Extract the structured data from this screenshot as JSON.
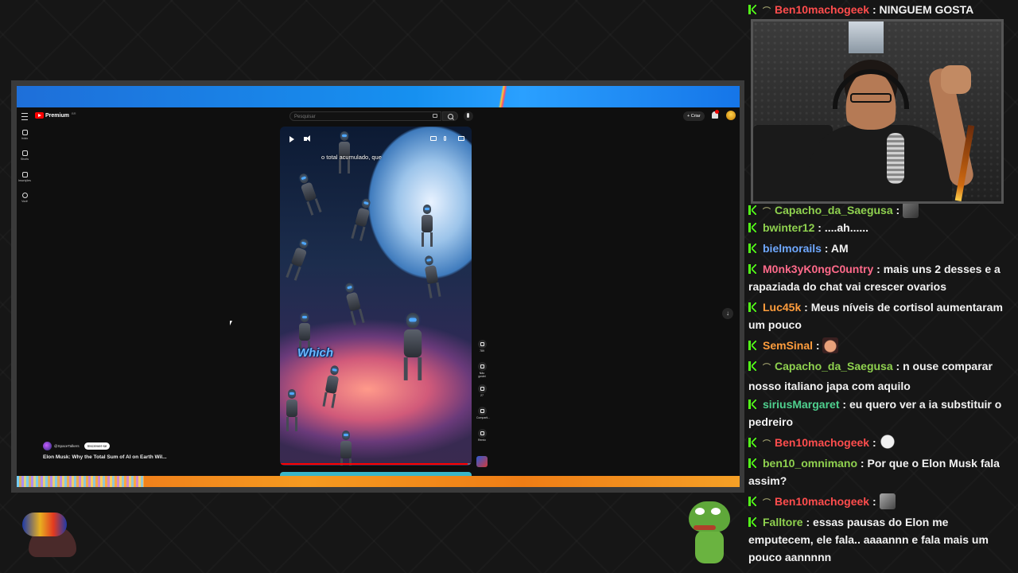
{
  "youtube": {
    "logo_text": "Premium",
    "logo_region": "BR",
    "search_placeholder": "Pesquisar",
    "create_label": "Criar",
    "sidebar": [
      {
        "label": "Início",
        "icon": "home-icon"
      },
      {
        "label": "Shorts",
        "icon": "shorts-icon"
      },
      {
        "label": "Inscrições",
        "icon": "subscriptions-icon"
      },
      {
        "label": "Você",
        "icon": "you-icon"
      }
    ],
    "video": {
      "caption": "o total acumulado, que",
      "overlay_word": "Which",
      "progress_percent": 98
    },
    "actions": [
      {
        "label": "789",
        "icon": "like-icon"
      },
      {
        "label": "Não gostei",
        "icon": "dislike-icon"
      },
      {
        "label": "27",
        "icon": "comment-icon"
      },
      {
        "label": "Comparti...",
        "icon": "share-icon"
      },
      {
        "label": "Remix",
        "icon": "remix-icon"
      }
    ],
    "channel": {
      "handle": "@SpaceTalkers",
      "subscribe_label": "Inscrever-se"
    },
    "video_title": "Elon Musk: Why the Total Sum of AI on Earth Wil..."
  },
  "chat": {
    "messages": [
      {
        "user": "Ben10machogeek",
        "color": "#ff4d4d",
        "hat": true,
        "text": "NINGUEM GOSTA"
      },
      {
        "user": "Capacho_da_Saegusa",
        "color": "#8fd14f",
        "hat": true,
        "text": "",
        "emote": "image-emote"
      },
      {
        "user": "bwinter12",
        "color": "#8fd14f",
        "hat": false,
        "text": "....ah......"
      },
      {
        "user": "bielmorails",
        "color": "#6fa8ff",
        "hat": false,
        "text": "AM"
      },
      {
        "user": "M0nk3yK0ngC0untry",
        "color": "#ff6a8a",
        "hat": false,
        "text": "mais uns 2 desses e a rapaziada do chat vai crescer ovarios"
      },
      {
        "user": "Luc45k",
        "color": "#ff9d3d",
        "hat": false,
        "text": "Meus níveis de cortisol aumentaram um pouco"
      },
      {
        "user": "SemSinal",
        "color": "#ff9d3d",
        "hat": false,
        "text": "",
        "emote": "hand-emote"
      },
      {
        "user": "Capacho_da_Saegusa",
        "color": "#8fd14f",
        "hat": true,
        "text": "n ouse comparar nosso italiano japa com aquilo"
      },
      {
        "user": "siriusMargaret",
        "color": "#4fd18f",
        "hat": false,
        "text": "eu quero ver a ia substituir o pedreiro"
      },
      {
        "user": "Ben10machogeek",
        "color": "#ff4d4d",
        "hat": true,
        "text": "",
        "emote": "ghost-emote"
      },
      {
        "user": "ben10_omnimano",
        "color": "#8fd14f",
        "hat": false,
        "text": "Por que o Elon Musk fala assim?"
      },
      {
        "user": "Ben10machogeek",
        "color": "#ff4d4d",
        "hat": true,
        "text": "",
        "emote": "photo-emote"
      },
      {
        "user": "Falltore",
        "color": "#8fd14f",
        "hat": false,
        "text": "essas pausas do Elon me emputecem, ele fala.. aaaannn e fala mais um pouco aannnnn"
      }
    ]
  }
}
